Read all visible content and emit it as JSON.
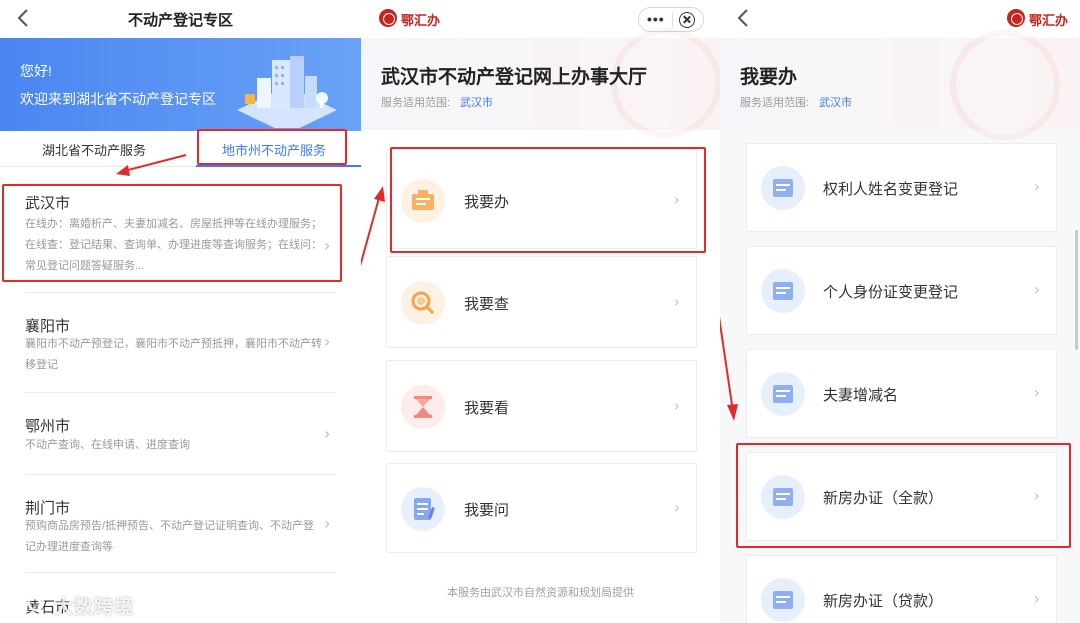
{
  "panel1": {
    "title": "不动产登记专区",
    "hero": {
      "greeting": "您好!",
      "welcome": "欢迎来到湖北省不动产登记专区"
    },
    "tabs": [
      {
        "label": "湖北省不动产服务"
      },
      {
        "label": "地市州不动产服务"
      }
    ],
    "cities": [
      {
        "name": "武汉市",
        "desc": "在线办：离婚析产、夫妻加减名、房屋抵押等在线办理服务；在线查：登记结果、查询单、办理进度等查询服务；在线问：常见登记问题答疑服务..."
      },
      {
        "name": "襄阳市",
        "desc": "襄阳市不动产预登记，襄阳市不动产预抵押，襄阳市不动产转移登记"
      },
      {
        "name": "鄂州市",
        "desc": "不动产查询、在线申请、进度查询"
      },
      {
        "name": "荆门市",
        "desc": "预购商品房预告/抵押预告、不动产登记证明查询、不动产登记办理进度查询等"
      },
      {
        "name": "黄石市",
        "desc": ""
      }
    ],
    "watermark": "大数跨境"
  },
  "panel2": {
    "brand": "鄂汇办",
    "title": "武汉市不动产登记网上办事大厅",
    "scope_label": "服务适用范围:",
    "scope_value": "武汉市",
    "services": [
      {
        "label": "我要办",
        "icon": "document-tray-icon"
      },
      {
        "label": "我要查",
        "icon": "magnifier-icon"
      },
      {
        "label": "我要看",
        "icon": "hourglass-icon"
      },
      {
        "label": "我要问",
        "icon": "notepad-icon"
      }
    ],
    "footer": "本服务由武汉市自然资源和规划局提供",
    "capsule": {
      "more": "•••"
    }
  },
  "panel3": {
    "brand": "鄂汇办",
    "title": "我要办",
    "scope_label": "服务适用范围:",
    "scope_value": "武汉市",
    "items": [
      {
        "label": "权利人姓名变更登记"
      },
      {
        "label": "个人身份证变更登记"
      },
      {
        "label": "夫妻增减名"
      },
      {
        "label": "新房办证（全款）"
      },
      {
        "label": "新房办证（贷款）"
      }
    ]
  },
  "colors": {
    "accent": "#3d7bf2",
    "annotation": "#e02b2b",
    "brand": "#c8231e"
  }
}
